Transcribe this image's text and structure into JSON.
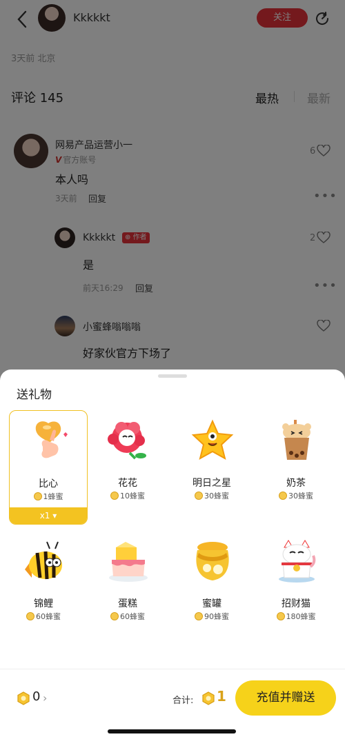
{
  "header": {
    "author_name": "Kkkkkt",
    "follow_label": "关注"
  },
  "post_meta": "3天前 北京",
  "comments_section": {
    "title": "评论 145",
    "sort_hot": "最热",
    "sort_new": "最新"
  },
  "comments": [
    {
      "name": "网易产品运营小一",
      "official_label": "官方账号",
      "text": "本人吗",
      "time": "3天前",
      "reply_label": "回复",
      "likes": "6"
    },
    {
      "name": "Kkkkkt",
      "author_badge": "作者",
      "text": "是",
      "time": "前天16:29",
      "reply_label": "回复",
      "likes": "2"
    },
    {
      "name": "小蜜蜂嗡嗡嗡",
      "text": "好家伙官方下场了"
    }
  ],
  "gift_sheet": {
    "title": "送礼物",
    "gifts": [
      {
        "name": "比心",
        "price": "1蜂蜜",
        "icon": "heart-hand-icon"
      },
      {
        "name": "花花",
        "price": "10蜂蜜",
        "icon": "flower-icon"
      },
      {
        "name": "明日之星",
        "price": "30蜂蜜",
        "icon": "star-icon"
      },
      {
        "name": "奶茶",
        "price": "30蜂蜜",
        "icon": "milk-tea-icon"
      },
      {
        "name": "锦鲤",
        "price": "60蜂蜜",
        "icon": "koi-bee-icon"
      },
      {
        "name": "蛋糕",
        "price": "60蜂蜜",
        "icon": "cake-icon"
      },
      {
        "name": "蜜罐",
        "price": "90蜂蜜",
        "icon": "honey-jar-icon"
      },
      {
        "name": "招财猫",
        "price": "180蜂蜜",
        "icon": "lucky-cat-icon"
      }
    ],
    "selected_quantity": "x1 ▾"
  },
  "footer": {
    "balance": "0",
    "total_label": "合计:",
    "total_value": "1",
    "cta_label": "充值并赠送"
  },
  "colors": {
    "accent_red": "#e8333a",
    "honey_yellow": "#f6d21a"
  }
}
